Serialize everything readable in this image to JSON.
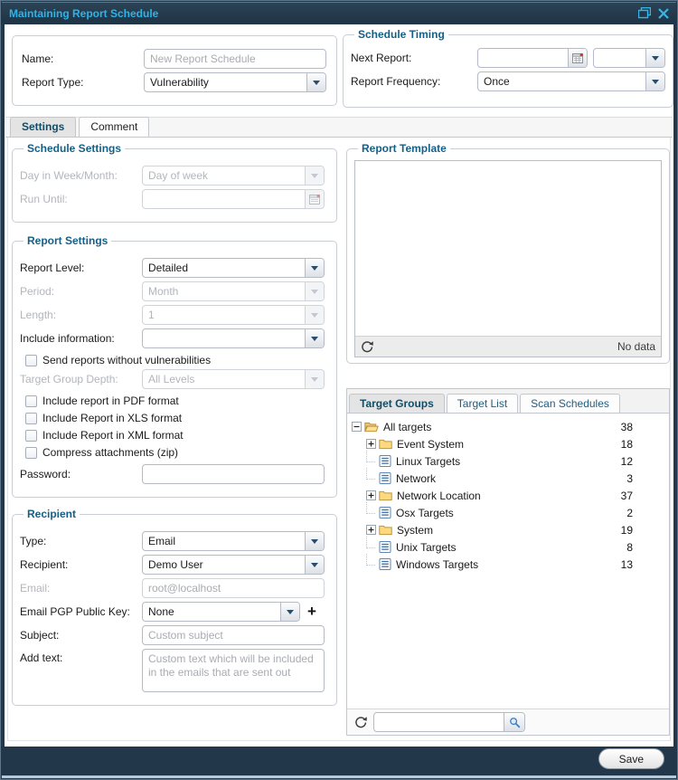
{
  "titlebar": {
    "title": "Maintaining Report Schedule"
  },
  "general": {
    "name_label": "Name:",
    "name_placeholder": "New Report Schedule",
    "type_label": "Report Type:",
    "type_value": "Vulnerability"
  },
  "timing": {
    "legend": "Schedule Timing",
    "next_label": "Next Report:",
    "next_date_value": "",
    "next_time_value": "",
    "freq_label": "Report Frequency:",
    "freq_value": "Once"
  },
  "main_tabs": [
    {
      "label": "Settings"
    },
    {
      "label": "Comment"
    }
  ],
  "schedule": {
    "legend": "Schedule Settings",
    "day_label": "Day in Week/Month:",
    "day_value": "Day of week",
    "until_label": "Run Until:",
    "until_value": ""
  },
  "report": {
    "legend": "Report Settings",
    "level_label": "Report Level:",
    "level_value": "Detailed",
    "period_label": "Period:",
    "period_value": "Month",
    "length_label": "Length:",
    "length_value": "1",
    "include_label": "Include information:",
    "include_value": "",
    "cb_no_vuln": "Send reports without vulnerabilities",
    "depth_label": "Target Group Depth:",
    "depth_value": "All Levels",
    "cb_pdf": "Include report in PDF format",
    "cb_xls": "Include Report in XLS format",
    "cb_xml": "Include Report in XML format",
    "cb_zip": "Compress attachments (zip)",
    "password_label": "Password:"
  },
  "recipient": {
    "legend": "Recipient",
    "type_label": "Type:",
    "type_value": "Email",
    "recipient_label": "Recipient:",
    "recipient_value": "Demo User",
    "email_label": "Email:",
    "email_value": "root@localhost",
    "pgp_label": "Email PGP Public Key:",
    "pgp_value": "None",
    "add_key_label": "+",
    "subject_label": "Subject:",
    "subject_placeholder": "Custom subject",
    "addtext_label": "Add text:",
    "addtext_placeholder": "Custom text which will be included in the emails that are sent out"
  },
  "template": {
    "legend": "Report Template",
    "empty_text": "No data"
  },
  "targets": {
    "tabs": [
      {
        "label": "Target Groups"
      },
      {
        "label": "Target List"
      },
      {
        "label": "Scan Schedules"
      }
    ],
    "tree": [
      {
        "label": "All targets",
        "count": "38",
        "depth": 0,
        "icon": "folder-open",
        "expander": "minus"
      },
      {
        "label": "Event System",
        "count": "18",
        "depth": 1,
        "icon": "folder",
        "expander": "plus"
      },
      {
        "label": "Linux Targets",
        "count": "12",
        "depth": 1,
        "icon": "leaf",
        "expander": "none"
      },
      {
        "label": "Network",
        "count": "3",
        "depth": 1,
        "icon": "leaf",
        "expander": "none"
      },
      {
        "label": "Network Location",
        "count": "37",
        "depth": 1,
        "icon": "folder",
        "expander": "plus"
      },
      {
        "label": "Osx Targets",
        "count": "2",
        "depth": 1,
        "icon": "leaf",
        "expander": "none"
      },
      {
        "label": "System",
        "count": "19",
        "depth": 1,
        "icon": "folder",
        "expander": "plus"
      },
      {
        "label": "Unix Targets",
        "count": "8",
        "depth": 1,
        "icon": "leaf",
        "expander": "none"
      },
      {
        "label": "Windows Targets",
        "count": "13",
        "depth": 1,
        "icon": "leaf",
        "expander": "none"
      }
    ],
    "search_value": ""
  },
  "footer": {
    "save": "Save"
  },
  "colors": {
    "titlebar_bg": "#22374a",
    "title_text": "#2cb3e8",
    "legend_text": "#155f87",
    "active_tab_text": "#114c67",
    "folder_icon": "#ffd97c",
    "disabled_text": "#b2b5bb"
  }
}
